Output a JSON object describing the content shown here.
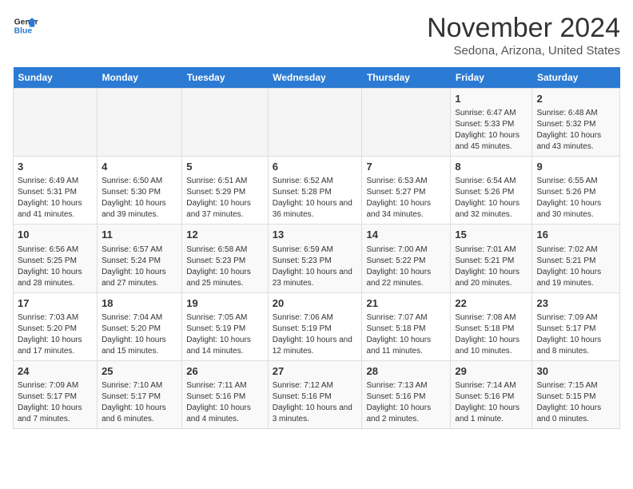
{
  "header": {
    "logo_line1": "General",
    "logo_line2": "Blue",
    "month": "November 2024",
    "location": "Sedona, Arizona, United States"
  },
  "weekdays": [
    "Sunday",
    "Monday",
    "Tuesday",
    "Wednesday",
    "Thursday",
    "Friday",
    "Saturday"
  ],
  "weeks": [
    [
      {
        "day": "",
        "info": ""
      },
      {
        "day": "",
        "info": ""
      },
      {
        "day": "",
        "info": ""
      },
      {
        "day": "",
        "info": ""
      },
      {
        "day": "",
        "info": ""
      },
      {
        "day": "1",
        "info": "Sunrise: 6:47 AM\nSunset: 5:33 PM\nDaylight: 10 hours and 45 minutes."
      },
      {
        "day": "2",
        "info": "Sunrise: 6:48 AM\nSunset: 5:32 PM\nDaylight: 10 hours and 43 minutes."
      }
    ],
    [
      {
        "day": "3",
        "info": "Sunrise: 6:49 AM\nSunset: 5:31 PM\nDaylight: 10 hours and 41 minutes."
      },
      {
        "day": "4",
        "info": "Sunrise: 6:50 AM\nSunset: 5:30 PM\nDaylight: 10 hours and 39 minutes."
      },
      {
        "day": "5",
        "info": "Sunrise: 6:51 AM\nSunset: 5:29 PM\nDaylight: 10 hours and 37 minutes."
      },
      {
        "day": "6",
        "info": "Sunrise: 6:52 AM\nSunset: 5:28 PM\nDaylight: 10 hours and 36 minutes."
      },
      {
        "day": "7",
        "info": "Sunrise: 6:53 AM\nSunset: 5:27 PM\nDaylight: 10 hours and 34 minutes."
      },
      {
        "day": "8",
        "info": "Sunrise: 6:54 AM\nSunset: 5:26 PM\nDaylight: 10 hours and 32 minutes."
      },
      {
        "day": "9",
        "info": "Sunrise: 6:55 AM\nSunset: 5:26 PM\nDaylight: 10 hours and 30 minutes."
      }
    ],
    [
      {
        "day": "10",
        "info": "Sunrise: 6:56 AM\nSunset: 5:25 PM\nDaylight: 10 hours and 28 minutes."
      },
      {
        "day": "11",
        "info": "Sunrise: 6:57 AM\nSunset: 5:24 PM\nDaylight: 10 hours and 27 minutes."
      },
      {
        "day": "12",
        "info": "Sunrise: 6:58 AM\nSunset: 5:23 PM\nDaylight: 10 hours and 25 minutes."
      },
      {
        "day": "13",
        "info": "Sunrise: 6:59 AM\nSunset: 5:23 PM\nDaylight: 10 hours and 23 minutes."
      },
      {
        "day": "14",
        "info": "Sunrise: 7:00 AM\nSunset: 5:22 PM\nDaylight: 10 hours and 22 minutes."
      },
      {
        "day": "15",
        "info": "Sunrise: 7:01 AM\nSunset: 5:21 PM\nDaylight: 10 hours and 20 minutes."
      },
      {
        "day": "16",
        "info": "Sunrise: 7:02 AM\nSunset: 5:21 PM\nDaylight: 10 hours and 19 minutes."
      }
    ],
    [
      {
        "day": "17",
        "info": "Sunrise: 7:03 AM\nSunset: 5:20 PM\nDaylight: 10 hours and 17 minutes."
      },
      {
        "day": "18",
        "info": "Sunrise: 7:04 AM\nSunset: 5:20 PM\nDaylight: 10 hours and 15 minutes."
      },
      {
        "day": "19",
        "info": "Sunrise: 7:05 AM\nSunset: 5:19 PM\nDaylight: 10 hours and 14 minutes."
      },
      {
        "day": "20",
        "info": "Sunrise: 7:06 AM\nSunset: 5:19 PM\nDaylight: 10 hours and 12 minutes."
      },
      {
        "day": "21",
        "info": "Sunrise: 7:07 AM\nSunset: 5:18 PM\nDaylight: 10 hours and 11 minutes."
      },
      {
        "day": "22",
        "info": "Sunrise: 7:08 AM\nSunset: 5:18 PM\nDaylight: 10 hours and 10 minutes."
      },
      {
        "day": "23",
        "info": "Sunrise: 7:09 AM\nSunset: 5:17 PM\nDaylight: 10 hours and 8 minutes."
      }
    ],
    [
      {
        "day": "24",
        "info": "Sunrise: 7:09 AM\nSunset: 5:17 PM\nDaylight: 10 hours and 7 minutes."
      },
      {
        "day": "25",
        "info": "Sunrise: 7:10 AM\nSunset: 5:17 PM\nDaylight: 10 hours and 6 minutes."
      },
      {
        "day": "26",
        "info": "Sunrise: 7:11 AM\nSunset: 5:16 PM\nDaylight: 10 hours and 4 minutes."
      },
      {
        "day": "27",
        "info": "Sunrise: 7:12 AM\nSunset: 5:16 PM\nDaylight: 10 hours and 3 minutes."
      },
      {
        "day": "28",
        "info": "Sunrise: 7:13 AM\nSunset: 5:16 PM\nDaylight: 10 hours and 2 minutes."
      },
      {
        "day": "29",
        "info": "Sunrise: 7:14 AM\nSunset: 5:16 PM\nDaylight: 10 hours and 1 minute."
      },
      {
        "day": "30",
        "info": "Sunrise: 7:15 AM\nSunset: 5:15 PM\nDaylight: 10 hours and 0 minutes."
      }
    ]
  ]
}
